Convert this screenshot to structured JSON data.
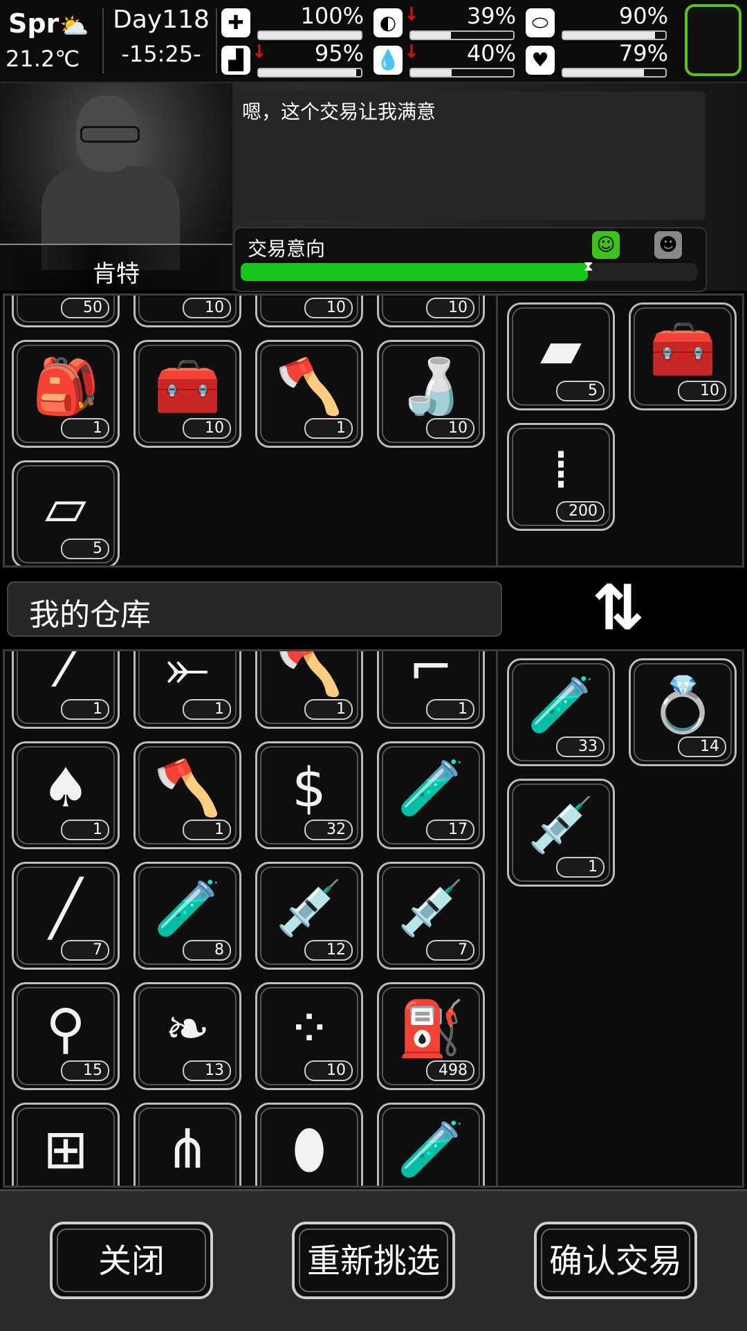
{
  "status": {
    "season": "Spr",
    "weather_icon": "partly-cloudy-icon",
    "temperature": "21.2℃",
    "day": "Day118",
    "time": "-15:25-",
    "stats": [
      {
        "name": "health",
        "icon": "first-aid-icon",
        "value": "100%",
        "level": 1.0,
        "warning": false
      },
      {
        "name": "hunger",
        "icon": "stomach-icon",
        "value": "39%",
        "level": 0.39,
        "warning": true
      },
      {
        "name": "mood",
        "icon": "pill-icon",
        "value": "90%",
        "level": 0.9,
        "warning": false
      },
      {
        "name": "stamina",
        "icon": "boot-icon",
        "value": "95%",
        "level": 0.95,
        "warning": true
      },
      {
        "name": "thirst",
        "icon": "water-drop-icon",
        "value": "40%",
        "level": 0.4,
        "warning": true
      },
      {
        "name": "heart",
        "icon": "heart-icon",
        "value": "79%",
        "level": 0.79,
        "warning": false
      }
    ],
    "equip_slot_color": "#5fc11f"
  },
  "npc": {
    "name": "肯特",
    "speech": "嗯，这个交易让我满意",
    "trade_label": "交易意向",
    "trade_level": 0.76,
    "bar_color": "#19c41b"
  },
  "npc_inventory": {
    "items": [
      {
        "icon": "leaf-icon",
        "count": "50"
      },
      {
        "icon": "gear-icon",
        "count": "10"
      },
      {
        "icon": "tool-icon",
        "count": "10"
      },
      {
        "icon": "scrap-icon",
        "count": "10"
      },
      {
        "icon": "backpack-icon",
        "count": "1"
      },
      {
        "icon": "toolbox-icon",
        "count": "10"
      },
      {
        "icon": "hatchet-icon",
        "count": "1"
      },
      {
        "icon": "water-bottle-icon",
        "count": "10"
      },
      {
        "icon": "cloth-icon",
        "count": "5"
      }
    ],
    "offer": [
      {
        "icon": "metal-plate-icon",
        "count": "5"
      },
      {
        "icon": "toolbox-open-icon",
        "count": "10"
      },
      {
        "icon": "bullets-icon",
        "count": "200"
      }
    ]
  },
  "storage": {
    "title": "我的仓库",
    "items": [
      {
        "icon": "baseball-bat-icon",
        "count": "1"
      },
      {
        "icon": "crossbow-icon",
        "count": "1"
      },
      {
        "icon": "axe-icon",
        "count": "1"
      },
      {
        "icon": "rifle-icon",
        "count": "1"
      },
      {
        "icon": "shovel-icon",
        "count": "1"
      },
      {
        "icon": "hatchet-icon",
        "count": "1"
      },
      {
        "icon": "cash-icon",
        "count": "32"
      },
      {
        "icon": "test-tube-v-icon",
        "count": "17"
      },
      {
        "icon": "cigarette-icon",
        "count": "7"
      },
      {
        "icon": "test-tube-vii-icon",
        "count": "8"
      },
      {
        "icon": "syringe-red-icon",
        "count": "12"
      },
      {
        "icon": "syringe-icon",
        "count": "7"
      },
      {
        "icon": "ampoule-icon",
        "count": "15"
      },
      {
        "icon": "herb-leaves-icon",
        "count": "13"
      },
      {
        "icon": "pills-icon",
        "count": "10"
      },
      {
        "icon": "fuel-can-icon",
        "count": "498"
      },
      {
        "icon": "net-icon",
        "count": ""
      },
      {
        "icon": "spray-cans-icon",
        "count": ""
      },
      {
        "icon": "medicine-bottle-icon",
        "count": ""
      },
      {
        "icon": "test-tube-vi-icon",
        "count": ""
      }
    ],
    "offer": [
      {
        "icon": "test-tube-vi-icon",
        "count": "33"
      },
      {
        "icon": "diamond-ring-icon",
        "count": "14"
      },
      {
        "icon": "syringe-icon",
        "count": "1"
      }
    ]
  },
  "buttons": {
    "close": "关闭",
    "reselect": "重新挑选",
    "confirm": "确认交易"
  }
}
